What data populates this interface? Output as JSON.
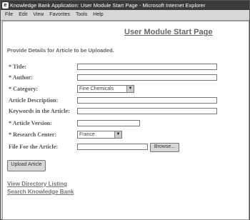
{
  "window": {
    "title": "Knowledge Bank Application: User Module Start Page - Microsoft Internet Explorer",
    "icon": "ie-icon"
  },
  "menu": [
    "File",
    "Edit",
    "View",
    "Favorites",
    "Tools",
    "Help"
  ],
  "page": {
    "title": "User Module Start Page",
    "instruction": "Provide Details for Article to be Uploaded."
  },
  "form": {
    "title_label": "* Title:",
    "author_label": "* Author:",
    "category_label": "* Category:",
    "category_value": "Fine Chemicals",
    "description_label": "Article Description:",
    "keywords_label": "Keywords in the Article:",
    "version_label": "* Article Version:",
    "research_center_label": "* Research Center:",
    "research_center_value": "France",
    "file_label": "File For the Article:",
    "browse_label": "Browse...",
    "upload_label": "Upload Article"
  },
  "links": {
    "directory": "View Directory Listing",
    "search": "Search Knowledge Bank"
  }
}
